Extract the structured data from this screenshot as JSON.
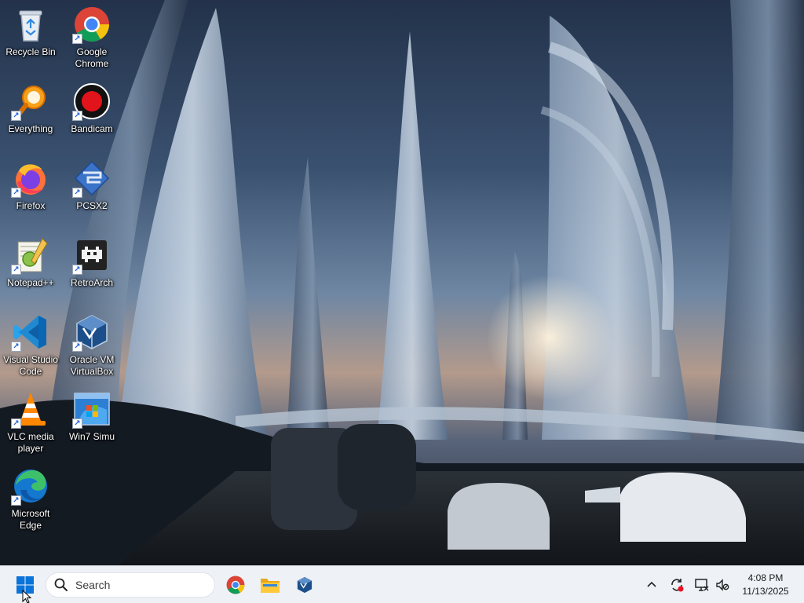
{
  "desktop": {
    "icons": [
      {
        "id": "recycle-bin",
        "label": "Recycle Bin",
        "icon": "recycle-bin-icon",
        "shortcut": false
      },
      {
        "id": "google-chrome",
        "label": "Google\nChrome",
        "icon": "chrome-icon",
        "shortcut": true
      },
      {
        "id": "everything",
        "label": "Everything",
        "icon": "everything-search-icon",
        "shortcut": true
      },
      {
        "id": "bandicam",
        "label": "Bandicam",
        "icon": "bandicam-record-icon",
        "shortcut": true
      },
      {
        "id": "firefox",
        "label": "Firefox",
        "icon": "firefox-icon",
        "shortcut": true
      },
      {
        "id": "pcsx2",
        "label": "PCSX2",
        "icon": "pcsx2-icon",
        "shortcut": true
      },
      {
        "id": "notepad-plus-plus",
        "label": "Notepad++",
        "icon": "notepad-plus-plus-icon",
        "shortcut": true
      },
      {
        "id": "retroarch",
        "label": "RetroArch",
        "icon": "retroarch-icon",
        "shortcut": true
      },
      {
        "id": "visual-studio-code",
        "label": "Visual Studio\nCode",
        "icon": "vscode-icon",
        "shortcut": true
      },
      {
        "id": "oracle-vm-virtualbox",
        "label": "Oracle VM\nVirtualBox",
        "icon": "virtualbox-icon",
        "shortcut": true
      },
      {
        "id": "vlc-media-player",
        "label": "VLC media\nplayer",
        "icon": "vlc-cone-icon",
        "shortcut": true
      },
      {
        "id": "win7-simu",
        "label": "Win7 Simu",
        "icon": "win7-simu-icon",
        "shortcut": true
      },
      {
        "id": "microsoft-edge",
        "label": "Microsoft\nEdge",
        "icon": "edge-icon",
        "shortcut": true
      }
    ]
  },
  "taskbar": {
    "start_icon": "windows-start-icon",
    "search": {
      "placeholder": "Search",
      "icon": "search-icon"
    },
    "pinned": [
      {
        "id": "chrome",
        "icon": "chrome-icon"
      },
      {
        "id": "file-explorer",
        "icon": "folder-icon"
      },
      {
        "id": "virtualbox",
        "icon": "virtualbox-icon"
      }
    ],
    "tray": [
      {
        "id": "show-hidden-icons",
        "icon": "chevron-up-icon"
      },
      {
        "id": "sync-status",
        "icon": "sync-alert-icon"
      },
      {
        "id": "network",
        "icon": "network-monitor-icon"
      },
      {
        "id": "volume",
        "icon": "speaker-muted-icon"
      }
    ],
    "clock": {
      "time": "4:08 PM",
      "date": "11/13/2025"
    }
  },
  "colors": {
    "taskbar_bg": "#eef1f6",
    "windows_blue": "#0a74da",
    "chrome_red": "#db4437",
    "chrome_yellow": "#f4c20d",
    "chrome_green": "#0f9d58",
    "chrome_blue": "#4285f4"
  }
}
